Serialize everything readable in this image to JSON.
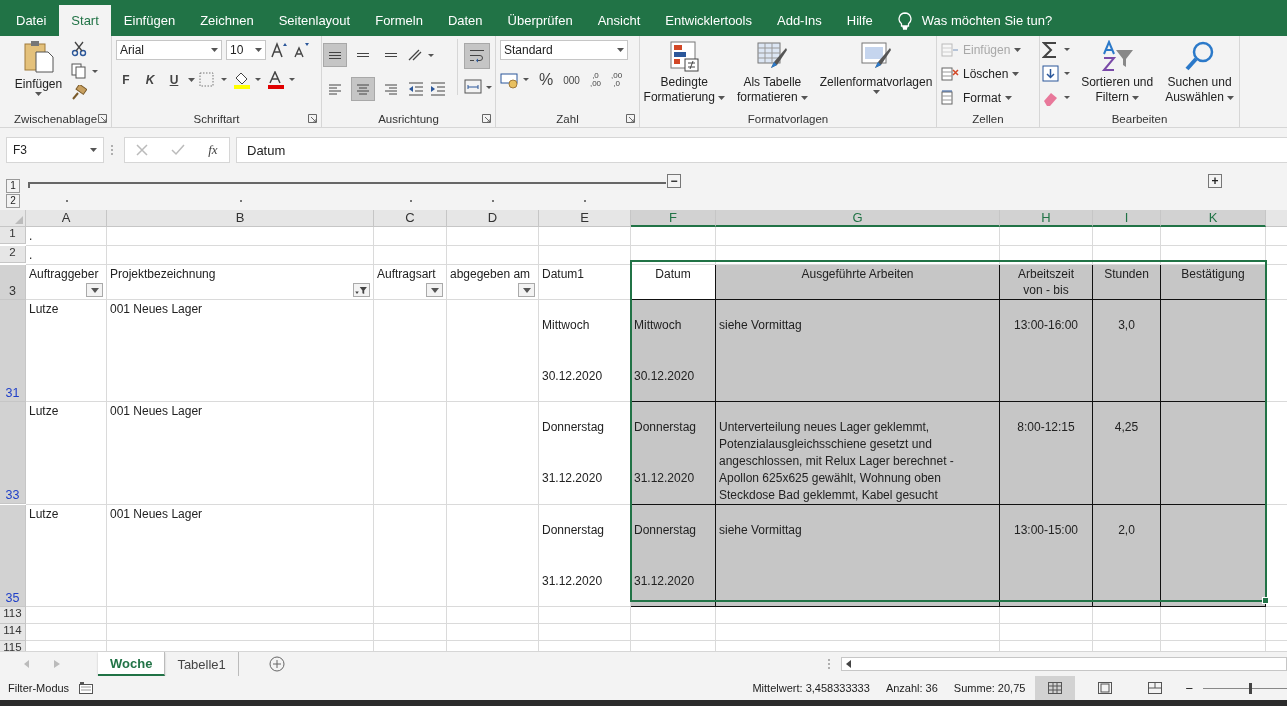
{
  "menu_tabs": [
    {
      "label": "Datei",
      "selected": false
    },
    {
      "label": "Start",
      "selected": true
    },
    {
      "label": "Einfügen",
      "selected": false
    },
    {
      "label": "Zeichnen",
      "selected": false
    },
    {
      "label": "Seitenlayout",
      "selected": false
    },
    {
      "label": "Formeln",
      "selected": false
    },
    {
      "label": "Daten",
      "selected": false
    },
    {
      "label": "Überprüfen",
      "selected": false
    },
    {
      "label": "Ansicht",
      "selected": false
    },
    {
      "label": "Entwicklertools",
      "selected": false
    },
    {
      "label": "Add-Ins",
      "selected": false
    },
    {
      "label": "Hilfe",
      "selected": false
    }
  ],
  "tell_me": "Was möchten Sie tun?",
  "ribbon": {
    "clipboard": {
      "paste": "Einfügen",
      "label": "Zwischenablage"
    },
    "font": {
      "family": "Arial",
      "size": "10",
      "bold": "F",
      "italic": "K",
      "underline": "U",
      "label": "Schriftart"
    },
    "alignment": {
      "label": "Ausrichtung",
      "vertical": [
        {
          "selected": true
        },
        {
          "selected": false
        },
        {
          "selected": false
        }
      ],
      "horizontal": [
        {
          "selected": false
        },
        {
          "selected": true
        },
        {
          "selected": false
        }
      ],
      "wrap_text": {
        "selected": true
      }
    },
    "number": {
      "format": "Standard",
      "percent": "%",
      "thousands": "000",
      "increase_decimal": [
        ",0",
        ",00"
      ],
      "decrease_decimal": [
        ",00",
        ",0"
      ],
      "label": "Zahl"
    },
    "styles": {
      "conditional": [
        "Bedingte",
        "Formatierung"
      ],
      "table": [
        "Als Tabelle",
        "formatieren"
      ],
      "cell_styles": "Zellenformatvorlagen",
      "label": "Formatvorlagen"
    },
    "cells": {
      "items": [
        {
          "label": "Einfügen",
          "disabled": true
        },
        {
          "label": "Löschen",
          "disabled": false
        },
        {
          "label": "Format",
          "disabled": false
        }
      ],
      "label": "Zellen"
    },
    "editing": {
      "sort": [
        "Sortieren und",
        "Filtern"
      ],
      "find": [
        "Suchen und",
        "Auswählen"
      ],
      "label": "Bearbeiten"
    }
  },
  "formula_bar": {
    "name_box": "F3",
    "function_symbol": "fx",
    "value": "Datum"
  },
  "outline": {
    "levels": [
      "1",
      "2"
    ],
    "collapse": "−",
    "expand": "+"
  },
  "columns": [
    {
      "letter": "A",
      "selected": false
    },
    {
      "letter": "B",
      "selected": false
    },
    {
      "letter": "C",
      "selected": false
    },
    {
      "letter": "D",
      "selected": false
    },
    {
      "letter": "E",
      "selected": false
    },
    {
      "letter": "F",
      "selected": true
    },
    {
      "letter": "G",
      "selected": true
    },
    {
      "letter": "H",
      "selected": true
    },
    {
      "letter": "I",
      "selected": true
    },
    {
      "letter": "K",
      "selected": true
    }
  ],
  "rows": [
    {
      "number": "1",
      "kind": "blank",
      "selected": false,
      "filtered": false,
      "cells": [
        {
          "lines": [
            "."
          ],
          "shaded": false
        }
      ]
    },
    {
      "number": "2",
      "kind": "blank",
      "selected": false,
      "filtered": false,
      "cells": [
        {
          "lines": [
            "."
          ],
          "shaded": false
        }
      ]
    },
    {
      "number": "3",
      "kind": "header",
      "selected": true,
      "filtered": false,
      "cells": [
        {
          "lines": [
            "Auftraggeber"
          ],
          "shaded": false,
          "filter": {
            "active": false
          }
        },
        {
          "lines": [
            "Projektbezeichnung"
          ],
          "shaded": false,
          "filter": {
            "active": true
          }
        },
        {
          "lines": [
            "Auftragsart"
          ],
          "shaded": false,
          "filter": {
            "active": false
          }
        },
        {
          "lines": [
            "abgegeben am"
          ],
          "shaded": false,
          "filter": {
            "active": false
          }
        },
        {
          "lines": [
            "Datum1"
          ],
          "shaded": false
        },
        {
          "lines": [
            "Datum"
          ],
          "shaded": false
        },
        {
          "lines": [
            "Ausgeführte Arbeiten"
          ],
          "shaded": true
        },
        {
          "lines": [
            "Arbeitszeit",
            "von - bis"
          ],
          "shaded": true
        },
        {
          "lines": [
            "Stunden"
          ],
          "shaded": true
        },
        {
          "lines": [
            "Bestätigung"
          ],
          "shaded": true
        }
      ]
    },
    {
      "number": "31",
      "kind": "record",
      "selected": true,
      "filtered": true,
      "cells": [
        {
          "lines": [
            "Lutze"
          ],
          "shaded": false
        },
        {
          "lines": [
            "001 Neues Lager"
          ],
          "shaded": false
        },
        {
          "shaded": false
        },
        {
          "shaded": false
        },
        {
          "lines": [
            "Mittwoch",
            "30.12.2020"
          ],
          "shaded": false
        },
        {
          "lines": [
            "Mittwoch",
            "30.12.2020"
          ],
          "shaded": true
        },
        {
          "lines": [
            "siehe Vormittag"
          ],
          "shaded": true
        },
        {
          "lines": [
            "13:00-16:00"
          ],
          "shaded": true
        },
        {
          "lines": [
            "3,0"
          ],
          "shaded": true
        },
        {
          "shaded": true
        }
      ]
    },
    {
      "number": "33",
      "kind": "record",
      "selected": true,
      "filtered": true,
      "cells": [
        {
          "lines": [
            "Lutze"
          ],
          "shaded": false
        },
        {
          "lines": [
            "001 Neues Lager"
          ],
          "shaded": false
        },
        {
          "shaded": false
        },
        {
          "shaded": false
        },
        {
          "lines": [
            "Donnerstag",
            "31.12.2020"
          ],
          "shaded": false
        },
        {
          "lines": [
            "Donnerstag",
            "31.12.2020"
          ],
          "shaded": true
        },
        {
          "lines": [
            "Unterverteilung neues Lager geklemmt, Potenzialausgleichsschiene gesetzt und angeschlossen, mit Relux Lager berechnet - Apollon 625x625 gewählt, Wohnung oben Steckdose Bad geklemmt, Kabel gesucht"
          ],
          "shaded": true
        },
        {
          "lines": [
            "8:00-12:15"
          ],
          "shaded": true
        },
        {
          "lines": [
            "4,25"
          ],
          "shaded": true
        },
        {
          "shaded": true
        }
      ]
    },
    {
      "number": "35",
      "kind": "record",
      "selected": true,
      "filtered": true,
      "cells": [
        {
          "lines": [
            "Lutze"
          ],
          "shaded": false
        },
        {
          "lines": [
            "001 Neues Lager"
          ],
          "shaded": false
        },
        {
          "shaded": false
        },
        {
          "shaded": false
        },
        {
          "lines": [
            "Donnerstag",
            "31.12.2020"
          ],
          "shaded": false
        },
        {
          "lines": [
            "Donnerstag",
            "31.12.2020"
          ],
          "shaded": true
        },
        {
          "lines": [
            "siehe Vormittag"
          ],
          "shaded": true
        },
        {
          "lines": [
            "13:00-15:00"
          ],
          "shaded": true
        },
        {
          "lines": [
            "2,0"
          ],
          "shaded": true
        },
        {
          "shaded": true
        }
      ]
    },
    {
      "number": "113",
      "kind": "blank",
      "selected": false,
      "filtered": false
    },
    {
      "number": "114",
      "kind": "blank",
      "selected": false,
      "filtered": false
    },
    {
      "number": "115",
      "kind": "blank",
      "selected": false,
      "filtered": false
    }
  ],
  "sheet_tabs": [
    {
      "label": "Woche",
      "selected": true
    },
    {
      "label": "Tabelle1",
      "selected": false
    }
  ],
  "status_bar": {
    "mode": "Filter-Modus",
    "stats": [
      "Mittelwert: 3,458333333",
      "Anzahl: 36",
      "Summe: 20,75"
    ],
    "views": [
      {
        "selected": true
      },
      {
        "selected": false
      },
      {
        "selected": false
      }
    ],
    "zoom_minus": "−",
    "zoom": {
      "level": 0.55
    }
  }
}
